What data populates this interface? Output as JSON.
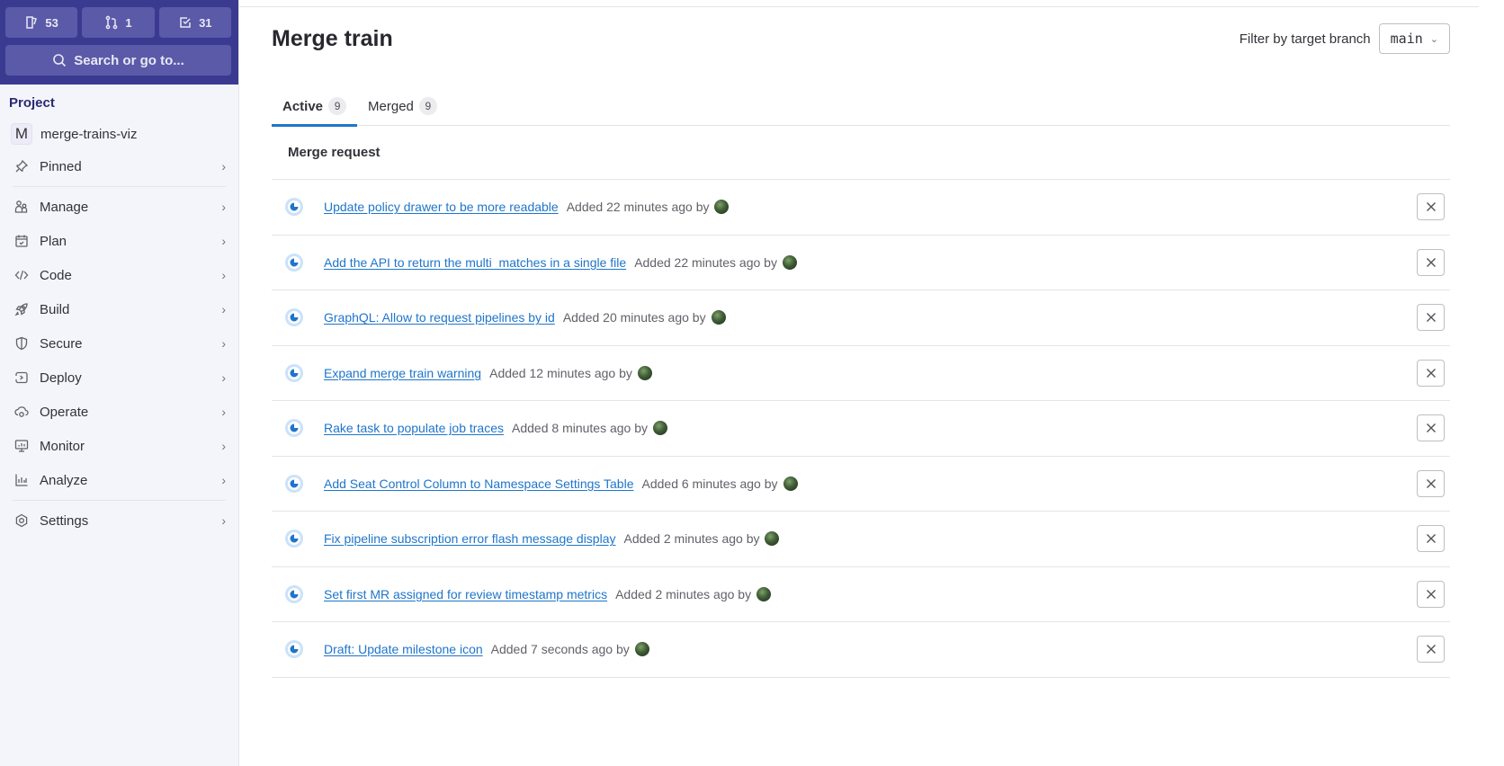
{
  "sidebar": {
    "counters": [
      {
        "icon": "issues-icon",
        "value": "53"
      },
      {
        "icon": "merge-request-icon",
        "value": "1"
      },
      {
        "icon": "todo-icon",
        "value": "31"
      }
    ],
    "search_label": "Search or go to...",
    "section_title": "Project",
    "project": {
      "avatar_letter": "M",
      "name": "merge-trains-viz"
    },
    "pinned_label": "Pinned",
    "items": [
      {
        "label": "Manage",
        "icon": "users-icon"
      },
      {
        "label": "Plan",
        "icon": "calendar-icon"
      },
      {
        "label": "Code",
        "icon": "code-icon"
      },
      {
        "label": "Build",
        "icon": "rocket-icon"
      },
      {
        "label": "Secure",
        "icon": "shield-icon"
      },
      {
        "label": "Deploy",
        "icon": "deploy-icon"
      },
      {
        "label": "Operate",
        "icon": "cloud-gear-icon"
      },
      {
        "label": "Monitor",
        "icon": "monitor-icon"
      },
      {
        "label": "Analyze",
        "icon": "chart-icon"
      }
    ],
    "settings_label": "Settings"
  },
  "header": {
    "title": "Merge train",
    "filter_label": "Filter by target branch",
    "branch": "main"
  },
  "tabs": [
    {
      "label": "Active",
      "count": "9",
      "active": true
    },
    {
      "label": "Merged",
      "count": "9",
      "active": false
    }
  ],
  "table": {
    "column_header": "Merge request",
    "rows": [
      {
        "title": "Update policy drawer to be more readable",
        "meta": "Added 22 minutes ago by"
      },
      {
        "title": "Add the API to return the multi_matches in a single file",
        "meta": "Added 22 minutes ago by"
      },
      {
        "title": "GraphQL: Allow to request pipelines by id",
        "meta": "Added 20 minutes ago by"
      },
      {
        "title": "Expand merge train warning",
        "meta": "Added 12 minutes ago by"
      },
      {
        "title": "Rake task to populate job traces",
        "meta": "Added 8 minutes ago by"
      },
      {
        "title": "Add Seat Control Column to Namespace Settings Table",
        "meta": "Added 6 minutes ago by"
      },
      {
        "title": "Fix pipeline subscription error flash message display",
        "meta": "Added 2 minutes ago by"
      },
      {
        "title": "Set first MR assigned for review timestamp metrics",
        "meta": "Added 2 minutes ago by"
      },
      {
        "title": "Draft: Update milestone icon",
        "meta": "Added 7 seconds ago by"
      }
    ]
  },
  "colors": {
    "brand": "#3b3a91",
    "link": "#1f75cb",
    "status_running": "#1f75cb"
  }
}
